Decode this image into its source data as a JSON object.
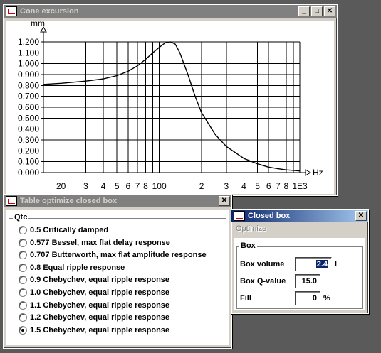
{
  "cone_window": {
    "title": "Cone excursion",
    "minimize": "_",
    "maximize": "□",
    "close": "✕"
  },
  "chart_data": {
    "type": "line",
    "title": "",
    "ylabel": "mm",
    "xlabel": "Hz",
    "x_scale": "log",
    "xlim": [
      15,
      1000
    ],
    "ylim": [
      0,
      1.2
    ],
    "grid": true,
    "y_ticks": [
      "0.000",
      "0.100",
      "0.200",
      "0.300",
      "0.400",
      "0.500",
      "0.600",
      "0.700",
      "0.800",
      "0.900",
      "1.000",
      "1.100",
      "1.200"
    ],
    "x_tick_labels": [
      "20",
      "3",
      "4",
      "5",
      "6",
      "7",
      "8",
      "100",
      "2",
      "3",
      "4",
      "5",
      "6",
      "7",
      "8",
      "1E3"
    ],
    "series": [
      {
        "x": [
          15,
          20,
          30,
          40,
          50,
          60,
          70,
          80,
          90,
          100,
          110,
          120,
          130,
          140,
          160,
          180,
          200,
          250,
          300,
          400,
          500,
          600,
          700,
          800,
          900,
          1000
        ],
        "y": [
          0.81,
          0.82,
          0.84,
          0.86,
          0.89,
          0.93,
          0.98,
          1.04,
          1.1,
          1.15,
          1.19,
          1.2,
          1.18,
          1.1,
          0.9,
          0.7,
          0.55,
          0.35,
          0.24,
          0.13,
          0.08,
          0.05,
          0.035,
          0.025,
          0.02,
          0.015
        ]
      }
    ]
  },
  "table_window": {
    "title": "Table optimize closed box",
    "close": "✕",
    "group_label": "Qtc",
    "options": [
      {
        "label": "0.5 Critically damped",
        "checked": false
      },
      {
        "label": "0.577 Bessel, max flat delay response",
        "checked": false
      },
      {
        "label": "0.707 Butterworth, max flat amplitude response",
        "checked": false
      },
      {
        "label": "0.8 Equal ripple response",
        "checked": false
      },
      {
        "label": "0.9 Chebychev, equal ripple response",
        "checked": false
      },
      {
        "label": "1.0 Chebychev, equal ripple response",
        "checked": false
      },
      {
        "label": "1.1 Chebychev, equal ripple response",
        "checked": false
      },
      {
        "label": "1.2 Chebychev, equal ripple response",
        "checked": false
      },
      {
        "label": "1.5 Chebychev, equal ripple response",
        "checked": true
      }
    ]
  },
  "closed_window": {
    "title": "Closed box",
    "close": "✕",
    "menu_optimize": "Optimize",
    "group_label": "Box",
    "box_volume_label": "Box volume",
    "box_volume_value": "2.4",
    "box_volume_unit": "l",
    "q_label": "Box Q-value",
    "q_value": "15.0",
    "fill_label": "Fill",
    "fill_value": "0",
    "fill_unit": "%"
  }
}
